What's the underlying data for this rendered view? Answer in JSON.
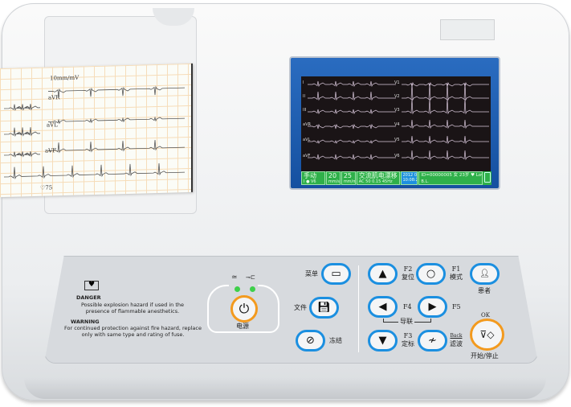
{
  "screen": {
    "leads_left": [
      "I",
      "II",
      "III",
      "aVR",
      "aVL",
      "aVF"
    ],
    "leads_right": [
      "V1",
      "V2",
      "V3",
      "V4",
      "V5",
      "V6"
    ],
    "status": {
      "mode": "手动",
      "mode_sub": "I  ● V6",
      "speed": "20",
      "speed_unit": "mm/s",
      "gain": "25",
      "gain_unit": "mm/mV",
      "filter": "交流肌电漂移",
      "filter_sub": "AC 50    0.15 45Hz",
      "date": "2012 07/12",
      "time": "10:08:28",
      "patient": "ID=00000005  女  23岁  ♥  Low",
      "patient_sub": "B.L."
    }
  },
  "printout": {
    "scale": "10mm/mV",
    "leads": [
      "aVR",
      "aVL",
      "aVF"
    ],
    "footer": "♡75"
  },
  "warnings": {
    "danger_title": "DANGER",
    "danger_text": "Possible explosion hazard if used in the presence of flammable anesthetics.",
    "warning_title": "WARNING",
    "warning_text": "For continued protection against fire hazard, replace only with same type and rating of fuse."
  },
  "power": {
    "label": "电源",
    "ac_symbol": "≃",
    "battery_symbol": "⊸⊏"
  },
  "buttons": {
    "menu": "菜单",
    "file": "文件",
    "freeze": "冻结",
    "f2": "F2",
    "reset": "复位",
    "f1": "F1",
    "mode": "模式",
    "patient": "患者",
    "f4": "F4",
    "f5": "F5",
    "leads": "导联",
    "f3": "F3",
    "calibrate": "定标",
    "back": "Back",
    "filter": "滤波",
    "ok": "OK",
    "start_stop": "开始/停止"
  },
  "colors": {
    "accent_blue": "#1b8fe0",
    "accent_orange": "#f39a1e",
    "screen_green": "#2fb04a",
    "bezel": "#1550a0"
  }
}
